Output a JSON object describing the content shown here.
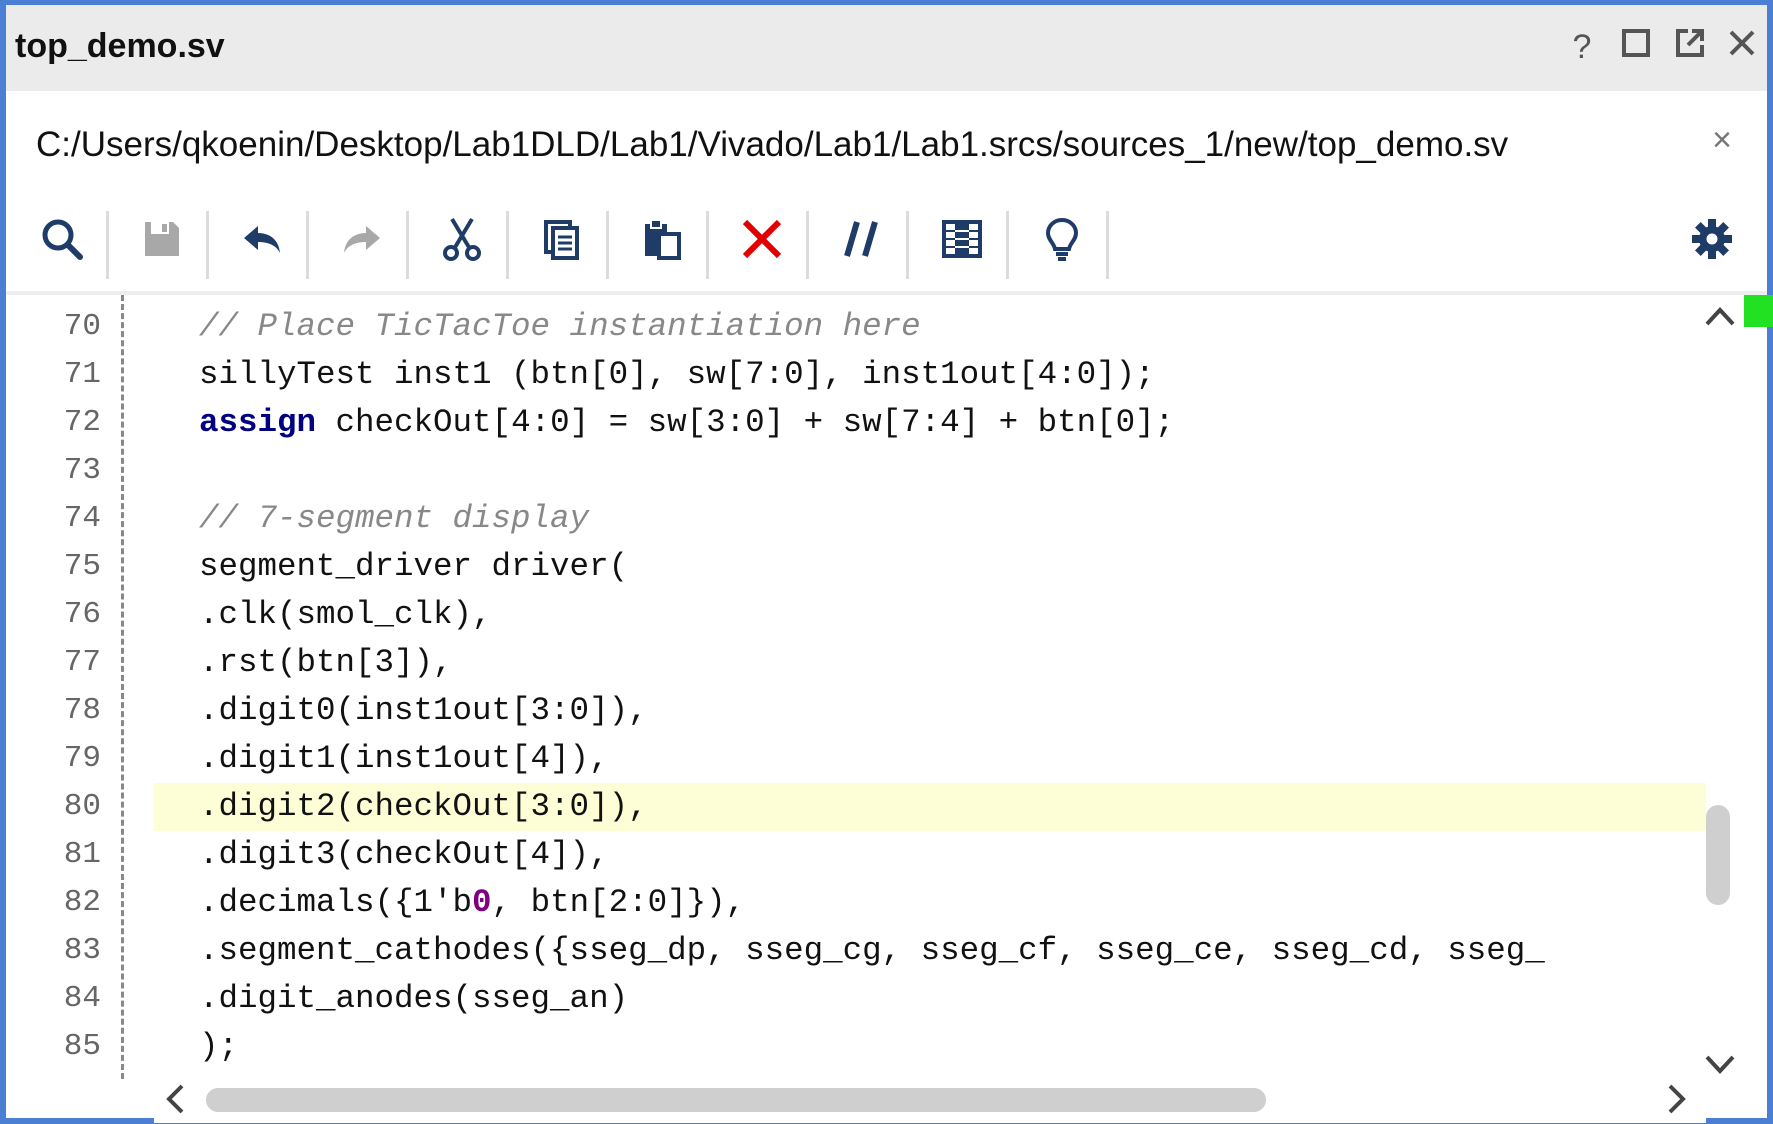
{
  "window": {
    "title": "top_demo.sv",
    "controls": [
      "?",
      "maximize",
      "popout",
      "close"
    ]
  },
  "file_path": {
    "path": "C:/Users/qkoenin/Desktop/Lab1DLD/Lab1/Vivado/Lab1/Lab1.srcs/sources_1/new/top_demo.sv",
    "close_label": "×"
  },
  "toolbar": {
    "tools": [
      "search-icon",
      "save-icon",
      "undo-icon",
      "redo-icon",
      "cut-icon",
      "copy-icon",
      "paste-icon",
      "delete-icon",
      "comment-icon",
      "block-select-icon",
      "hint-icon"
    ],
    "settings": "gear-icon"
  },
  "colors": {
    "accent": "#4a7fd4",
    "icon": "#1f3c68",
    "keyword": "#000080",
    "comment": "#888888",
    "highlight_line": "#fdfdd6",
    "delete": "#e00000",
    "marker": "#22e022"
  },
  "editor": {
    "highlighted_line": "80",
    "lines": [
      {
        "n": "70",
        "text": "// Place TicTacToe instantiation here"
      },
      {
        "n": "71",
        "text": "sillyTest inst1 (btn[0], sw[7:0], inst1out[4:0]);"
      },
      {
        "n": "72",
        "text": "assign checkOut[4:0] = sw[3:0] + sw[7:4] + btn[0];"
      },
      {
        "n": "73",
        "text": ""
      },
      {
        "n": "74",
        "text": "// 7-segment display"
      },
      {
        "n": "75",
        "text": "segment_driver driver("
      },
      {
        "n": "76",
        "text": ".clk(smol_clk),"
      },
      {
        "n": "77",
        "text": ".rst(btn[3]),"
      },
      {
        "n": "78",
        "text": ".digit0(inst1out[3:0]),"
      },
      {
        "n": "79",
        "text": ".digit1(inst1out[4]),"
      },
      {
        "n": "80",
        "text": ".digit2(checkOut[3:0]),"
      },
      {
        "n": "81",
        "text": ".digit3(checkOut[4]),"
      },
      {
        "n": "82",
        "text": ".decimals({1'b0, btn[2:0]}),"
      },
      {
        "n": "83",
        "text": ".segment_cathodes({sseg_dp, sseg_cg, sseg_cf, sseg_ce, sseg_cd, sseg_"
      },
      {
        "n": "84",
        "text": ".digit_anodes(sseg_an)"
      },
      {
        "n": "85",
        "text": ");"
      }
    ]
  }
}
